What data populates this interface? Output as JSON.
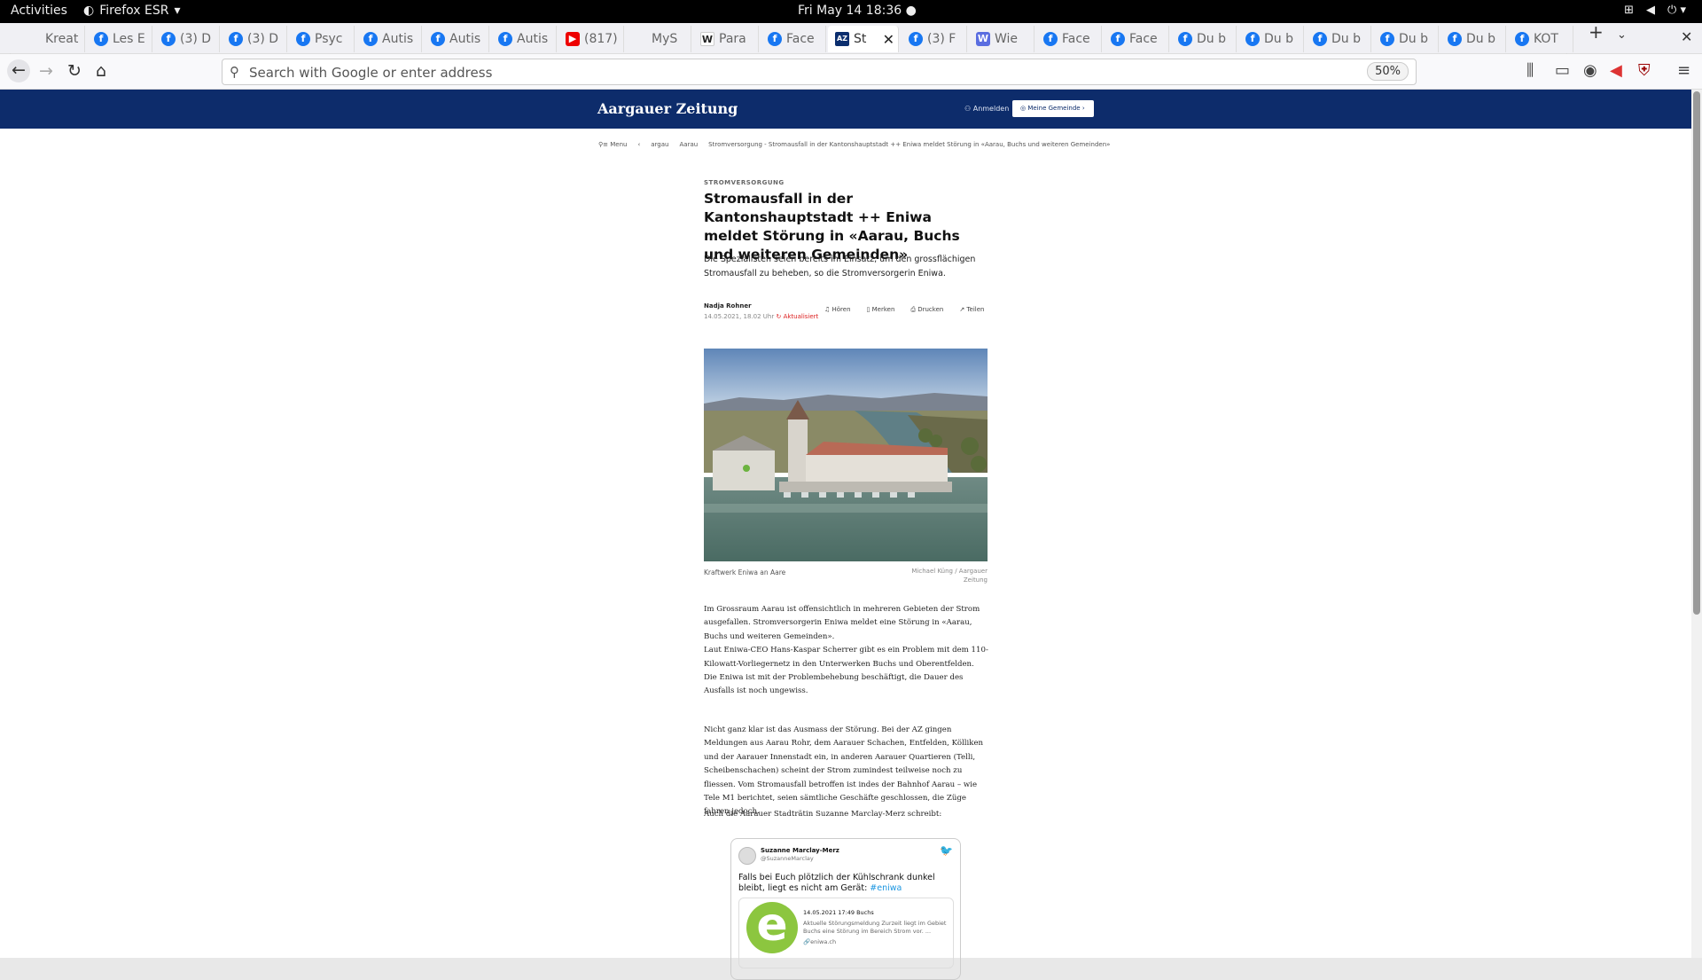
{
  "system": {
    "activities": "Activities",
    "browser": "Firefox ESR",
    "clock": "Fri May 14  18:36"
  },
  "tabs": [
    {
      "label": "Kreat",
      "icon": "blank"
    },
    {
      "label": "Les E",
      "icon": "facebook"
    },
    {
      "label": "(3) D",
      "icon": "facebook"
    },
    {
      "label": "(3) D",
      "icon": "facebook"
    },
    {
      "label": "Psyc",
      "icon": "facebook"
    },
    {
      "label": "Autis",
      "icon": "facebook"
    },
    {
      "label": "Autis",
      "icon": "facebook"
    },
    {
      "label": "Autis",
      "icon": "facebook"
    },
    {
      "label": "(817)",
      "icon": "youtube"
    },
    {
      "label": "MyS",
      "icon": "blank"
    },
    {
      "label": "Para",
      "icon": "wikipedia"
    },
    {
      "label": "Face",
      "icon": "facebook"
    },
    {
      "label": "St",
      "icon": "az",
      "active": true
    },
    {
      "label": "(3) F",
      "icon": "facebook"
    },
    {
      "label": "Wie",
      "icon": "wie"
    },
    {
      "label": "Face",
      "icon": "facebook"
    },
    {
      "label": "Face",
      "icon": "facebook"
    },
    {
      "label": "Du b",
      "icon": "facebook"
    },
    {
      "label": "Du b",
      "icon": "facebook"
    },
    {
      "label": "Du b",
      "icon": "facebook"
    },
    {
      "label": "Du b",
      "icon": "facebook"
    },
    {
      "label": "Du b",
      "icon": "facebook"
    },
    {
      "label": "KOT",
      "icon": "facebook"
    }
  ],
  "navbar": {
    "placeholder": "Search with Google or enter address",
    "zoom": "50%"
  },
  "site": {
    "logo": "Aargauer Zeitung",
    "login": "Anmelden",
    "my_community": "Meine Gemeinde"
  },
  "breadcrumb": {
    "menu": "Menu",
    "items": [
      "argau",
      "Aarau",
      "Stromversorgung - Stromausfall in der Kantonshauptstadt ++ Eniwa meldet Störung in «Aarau, Buchs und weiteren Gemeinden»"
    ]
  },
  "article": {
    "kicker": "STROMVERSORGUNG",
    "headline": "Stromausfall in der Kantonshauptstadt ++ Eniwa meldet Störung in «Aarau, Buchs und weiteren Gemeinden»",
    "lead": "Die Spezialisten seien bereits im Einsatz, um den grossflächigen Stromausfall zu beheben, so die Stromversorgerin Eniwa.",
    "author": "Nadja Rohner",
    "date": "14.05.2021, 18.02 Uhr",
    "updated": "Aktualisiert",
    "actions": {
      "listen": "Hören",
      "bookmark": "Merken",
      "print": "Drucken",
      "share": "Teilen"
    },
    "caption": "Kraftwerk Eniwa an Aare",
    "credit": "Michael Küng / Aargauer Zeitung",
    "p1": "Im Grossraum Aarau ist offensichtlich in mehreren Gebieten der Strom ausgefallen. Stromversorgerin Eniwa meldet eine Störung in «Aarau, Buchs und weiteren Gemeinden».",
    "p1b": "Laut Eniwa-CEO Hans-Kaspar Scherrer gibt es ein Problem mit dem 110-Kilowatt-Vorliegernetz in den Unterwerken Buchs und Oberentfelden. Die Eniwa ist mit der Problembehebung beschäftigt, die Dauer des Ausfalls ist noch ungewiss.",
    "p2": "Nicht ganz klar ist das Ausmass der Störung. Bei der AZ gingen Meldungen aus Aarau Rohr, dem Aarauer Schachen, Entfelden, Kölliken und der Aarauer Innenstadt ein, in anderen Aarauer Quartieren (Telli, Scheibenschachen) scheint der Strom zumindest teilweise noch zu fliessen. Vom Stromausfall betroffen ist indes der Bahnhof Aarau – wie Tele M1 berichtet, seien sämtliche Geschäfte geschlossen, die Züge fahren jedoch.",
    "p3": "Auch die Aarauer Stadträtin Suzanne Marclay-Merz schreibt:"
  },
  "tweet": {
    "name": "Suzanne Marclay-Merz",
    "handle": "@SuzanneMarclay",
    "text": "Falls bei Euch plötzlich der Kühlschrank dunkel bleibt, liegt  es   nicht am Gerät:",
    "hashtag": "#eniwa",
    "card_title": "14.05.2021 17:49 Buchs",
    "card_desc": "Aktuelle Störungsmeldung Zurzeit liegt im Gebiet Buchs eine Störung im Bereich Strom vor. ...",
    "card_url": "eniwa.ch"
  }
}
